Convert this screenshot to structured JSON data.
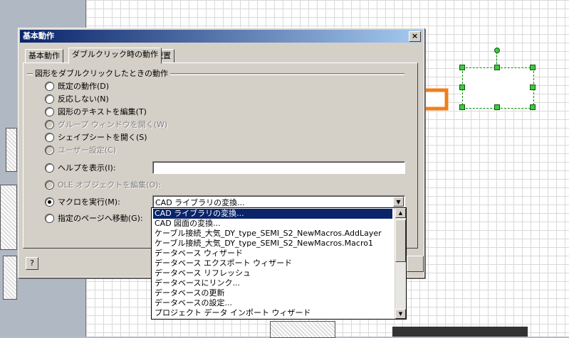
{
  "dialog": {
    "title": "基本動作",
    "close_label": "×",
    "tabs": [
      {
        "label": "基本動作",
        "active": false
      },
      {
        "label": "ダブルクリック時の動作",
        "active": true
      },
      {
        "label": "配置",
        "active": false
      }
    ],
    "group_label": "図形をダブルクリックしたときの動作",
    "options": [
      {
        "label": "既定の動作(D)",
        "enabled": true,
        "checked": false
      },
      {
        "label": "反応しない(N)",
        "enabled": true,
        "checked": false
      },
      {
        "label": "図形のテキストを編集(T)",
        "enabled": true,
        "checked": false
      },
      {
        "label": "グループ ウィンドウを開く(W)",
        "enabled": false,
        "checked": false
      },
      {
        "label": "シェイプシートを開く(S)",
        "enabled": true,
        "checked": false
      },
      {
        "label": "ユーザー設定(C)",
        "enabled": false,
        "checked": false
      },
      {
        "label": "ヘルプを表示(I):",
        "enabled": true,
        "checked": false
      },
      {
        "label": "OLE オブジェクトを編集(O):",
        "enabled": false,
        "checked": false
      },
      {
        "label": "マクロを実行(M):",
        "enabled": true,
        "checked": true
      },
      {
        "label": "指定のページへ移動(G):",
        "enabled": true,
        "checked": false
      }
    ],
    "help_input_value": "",
    "macro_combo_value": "CAD ライブラリの変換...",
    "help_button_label": "?"
  },
  "macro_list": {
    "selected_index": 0,
    "items": [
      "CAD ライブラリの変換...",
      "CAD 図面の変換...",
      "ケーブル接続_大気_DY_type_SEMI_S2_NewMacros.AddLayer",
      "ケーブル接続_大気_DY_type_SEMI_S2_NewMacros.Macro1",
      "データベース ウィザード",
      "データベース エクスポート ウィザード",
      "データベース リフレッシュ",
      "データベースにリンク...",
      "データベースの更新",
      "データベースの設定...",
      "プロジェクト データ インポート ウィザード"
    ]
  },
  "colors": {
    "title_bar": "#0a246a",
    "selection": "#0a246a",
    "arrow_annotation": "#f07f1e",
    "shape_handles": "#3ec93e"
  }
}
